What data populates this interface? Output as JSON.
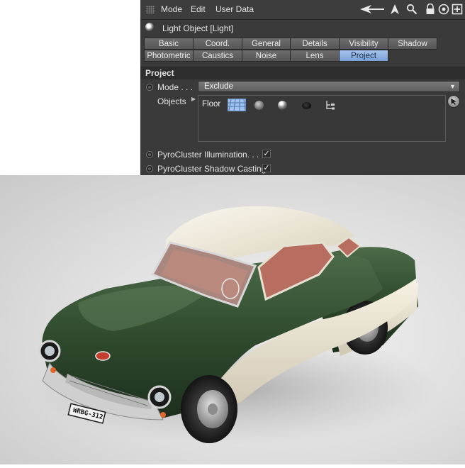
{
  "menu": {
    "items": [
      "Mode",
      "Edit",
      "User Data"
    ]
  },
  "toolbar": {
    "icons": [
      "back-arrow-icon",
      "cursor-icon",
      "search-icon",
      "lock-icon",
      "target-icon",
      "new-panel-icon"
    ]
  },
  "object": {
    "title": "Light Object [Light]",
    "icon": "light-object-icon"
  },
  "tabs": {
    "row1": [
      "Basic",
      "Coord.",
      "General",
      "Details",
      "Visibility",
      "Shadow"
    ],
    "row2": [
      "Photometric",
      "Caustics",
      "Noise",
      "Lens",
      "Project"
    ],
    "active": "Project"
  },
  "section": {
    "title": "Project"
  },
  "mode": {
    "label": "Mode . . .",
    "value": "Exclude"
  },
  "objects": {
    "label": "Objects",
    "items": [
      {
        "name": "Floor",
        "icons": [
          "floor-icon",
          "sphere-grey-icon",
          "sphere-shiny-icon",
          "sphere-dark-icon",
          "hierarchy-icon"
        ]
      }
    ]
  },
  "options": [
    {
      "label": "PyroCluster Illumination. . . .",
      "checked": "✓"
    },
    {
      "label": "PyroCluster Shadow Casting",
      "checked": "✓"
    }
  ],
  "render": {
    "plate_text": "WRBG-312",
    "colors": {
      "body_green": "#2f4a2e",
      "roof_cream": "#e9e2cf",
      "interior_red": "#b5665a"
    }
  }
}
